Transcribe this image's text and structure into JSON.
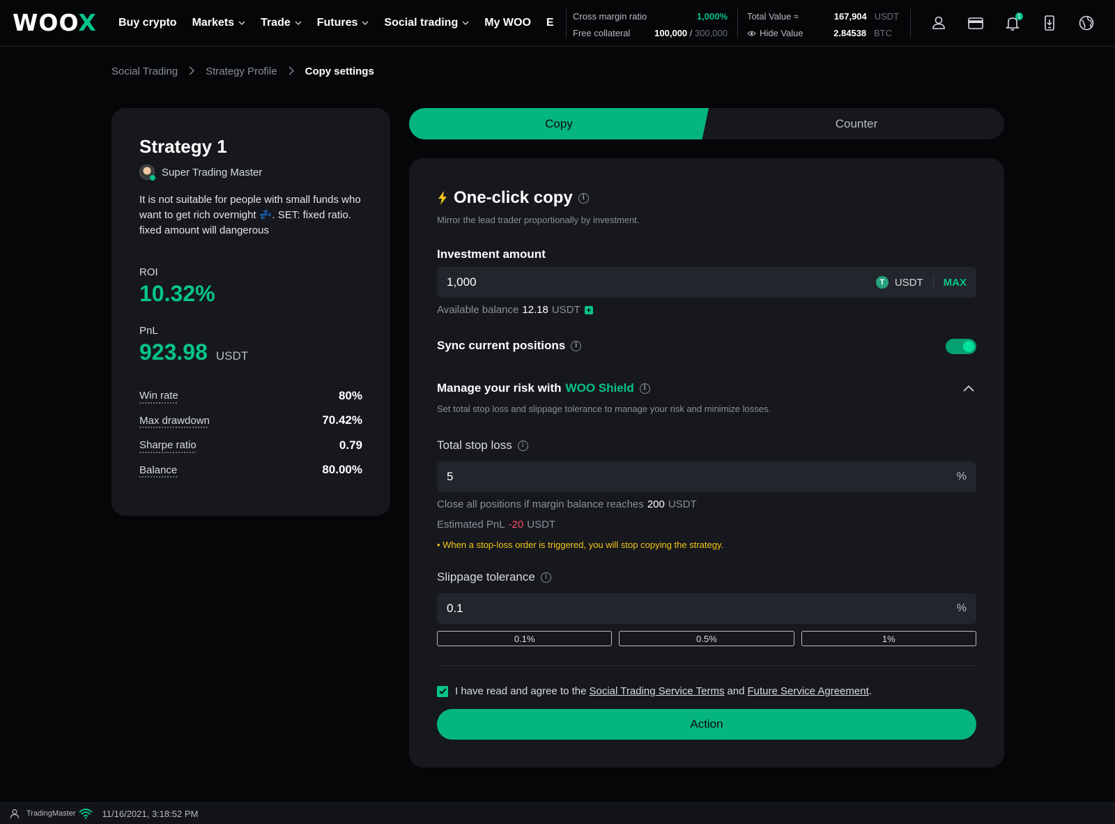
{
  "app": {
    "logo_main": "WOO",
    "logo_accent": "X"
  },
  "nav": {
    "items": [
      {
        "label": "Buy crypto",
        "dropdown": false
      },
      {
        "label": "Markets",
        "dropdown": true
      },
      {
        "label": "Trade",
        "dropdown": true
      },
      {
        "label": "Futures",
        "dropdown": true
      },
      {
        "label": "Social trading",
        "dropdown": true
      },
      {
        "label": "My WOO",
        "dropdown": false
      },
      {
        "label": "Earn",
        "dropdown": false
      }
    ],
    "account": {
      "cross_margin_label": "Cross margin ratio",
      "cross_margin_value": "1,000%",
      "free_collateral_label": "Free collateral",
      "free_collateral_value": "100,000",
      "free_collateral_sep": " / ",
      "free_collateral_total": "300,000",
      "total_value_label": "Total Value ≈",
      "hide_value_label": "Hide Value",
      "total_usdt": "167,904",
      "usdt_unit": "USDT",
      "total_btc": "2.84538",
      "btc_unit": "BTC"
    },
    "icons": [
      "user-icon",
      "wallet-icon",
      "bell-icon",
      "download-app-icon",
      "globe-icon"
    ],
    "bell_count": "1"
  },
  "breadcrumb": {
    "items": [
      "Social Trading",
      "Strategy Profile"
    ],
    "current": "Copy settings"
  },
  "strategy": {
    "title": "Strategy 1",
    "trader": "Super Trading Master",
    "desc_before": "It is not suitable for people with small funds who want to get rich overnight ",
    "desc_emoji": "💤",
    "desc_after": ". SET: fixed ratio. fixed amount will dangerous",
    "roi_label": "ROI",
    "roi_value": "10.32%",
    "pnl_label": "PnL",
    "pnl_value": "923.98",
    "pnl_unit": "USDT",
    "stats": [
      {
        "label": "Win rate",
        "value": "80%"
      },
      {
        "label": "Max drawdown",
        "value": "70.42%"
      },
      {
        "label": "Sharpe ratio",
        "value": "0.79"
      },
      {
        "label": "Balance",
        "value": "80.00%"
      }
    ]
  },
  "tabs": {
    "copy": "Copy",
    "counter": "Counter",
    "active": "copy"
  },
  "form": {
    "title": "One-click copy",
    "subtitle": "Mirror the lead trader proportionally by investment.",
    "investment_label": "Investment amount",
    "investment_value": "1,000",
    "coin_icon": "T",
    "coin": "USDT",
    "max": "MAX",
    "available_label": "Available balance",
    "available_value": "12.18",
    "available_unit": "USDT",
    "sync_label": "Sync current positions",
    "sync_on": true,
    "risk_label": "Manage your risk with",
    "risk_brand": "WOO Shield",
    "risk_desc": "Set total stop loss and slippage tolerance to manage your risk and minimize losses.",
    "stop_loss_label": "Total stop loss",
    "stop_loss_value": "5",
    "pct": "%",
    "close_label": "Close all positions if margin balance reaches",
    "close_value": "200",
    "close_unit": "USDT",
    "est_pnl_label": "Estimated PnL",
    "est_pnl_value": "-20",
    "est_pnl_unit": "USDT",
    "warning": "• When a stop-loss order is triggered, you will stop copying the strategy.",
    "slippage_label": "Slippage tolerance",
    "slippage_value": "0.1",
    "presets": [
      "0.1%",
      "0.5%",
      "1%"
    ],
    "agree_prefix": "I have read and agree to the",
    "terms_link": "Social Trading Service Terms",
    "agree_and": "and",
    "agreement_link": "Future Service Agreement",
    "agree_suffix": ".",
    "agreed": true,
    "action": "Action"
  },
  "status": {
    "user": "TradingMaster",
    "time": "11/16/2021, 3:18:52 PM"
  },
  "colors": {
    "accent": "#05c48a",
    "button": "#05b57f",
    "negative": "#ff4d6a",
    "warning": "#f5c518",
    "card": "#16181d",
    "bg": "#050608"
  }
}
